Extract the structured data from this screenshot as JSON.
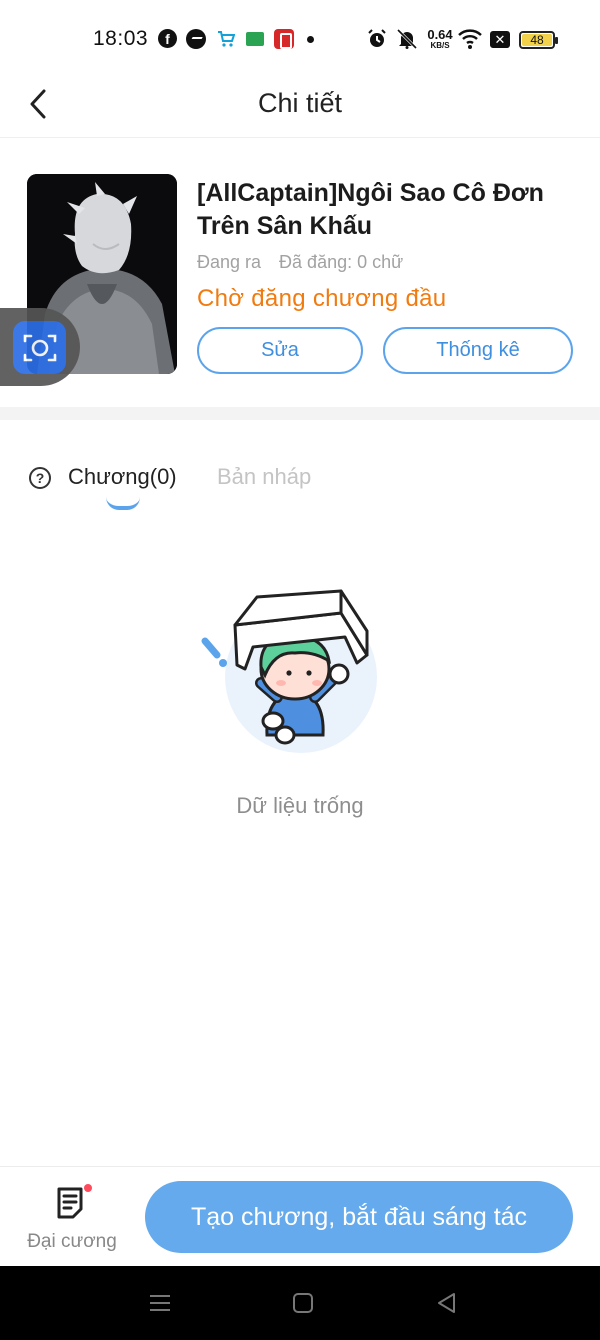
{
  "status_bar": {
    "time": "18:03",
    "net_speed_value": "0.64",
    "net_speed_unit": "KB/S",
    "battery": "48",
    "icons": [
      "facebook-icon",
      "messenger-icon",
      "shop-cart-icon",
      "green-app-icon",
      "red-app-icon",
      "dot-icon",
      "alarm-icon",
      "mute-icon",
      "wifi-icon",
      "x-icon",
      "battery-icon"
    ]
  },
  "header": {
    "title": "Chi tiết",
    "back_icon": "chevron-left-icon"
  },
  "book": {
    "title": "[AllCaptain]Ngôi Sao Cô Đơn Trên Sân Khấu",
    "status_label": "Đang ra",
    "word_count": "Đã đăng: 0 chữ",
    "publish_status": "Chờ đăng chương đầu",
    "edit_label": "Sửa",
    "stats_label": "Thống kê"
  },
  "tabs": {
    "help_icon": "question-icon",
    "items": [
      {
        "label": "Chương(0)",
        "active": true
      },
      {
        "label": "Bản nháp",
        "active": false
      }
    ]
  },
  "empty_state": {
    "text": "Dữ liệu trống"
  },
  "bottom_bar": {
    "outline_label": "Đại cương",
    "create_label": "Tạo chương, bắt đầu sáng tác"
  },
  "colors": {
    "accent": "#5ba4eb",
    "primary_button": "#64aaec",
    "status_orange": "#f07b11",
    "notification_dot": "#ff4b5c"
  }
}
